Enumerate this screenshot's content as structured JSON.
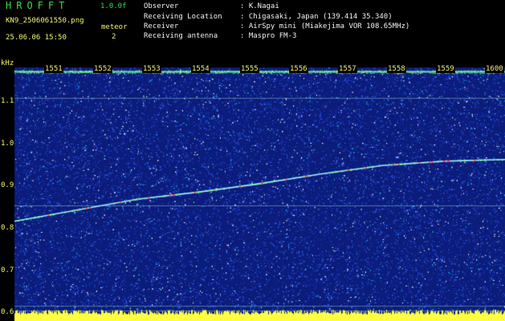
{
  "header": {
    "app_title": "HROFFT",
    "version": "1.0.0f",
    "filename": "KN9_2506061550.png",
    "meteor_label": "meteor",
    "meteor_count": "2",
    "datetime": "25.06.06 15:50"
  },
  "info": [
    {
      "key": "Observer",
      "value": ": K.Nagai"
    },
    {
      "key": "Receiving Location",
      "value": ": Chigasaki, Japan (139.414 35.340)"
    },
    {
      "key": "Receiver",
      "value": ": AirSpy mini (Miakejima VOR 108.65MHz)"
    },
    {
      "key": "Receiving antenna",
      "value": ": Maspro FM-3"
    }
  ],
  "chart_data": {
    "type": "heatmap",
    "ylabel": "kHz",
    "y_ticks": [
      "1.1",
      "1.0",
      "0.9",
      "0.8",
      "0.7",
      "0.6"
    ],
    "x_ticks": [
      "1551",
      "1552",
      "1553",
      "1554",
      "1555",
      "1556",
      "1557",
      "1558",
      "1559",
      "1600"
    ],
    "ylim": [
      0.58,
      1.18
    ],
    "trace": [
      {
        "t": "15:50",
        "khz": 0.816
      },
      {
        "t": "15:52",
        "khz": 0.842
      },
      {
        "t": "15:54",
        "khz": 0.868
      },
      {
        "t": "15:55",
        "khz": 0.885
      },
      {
        "t": "15:56",
        "khz": 0.905
      },
      {
        "t": "15:57",
        "khz": 0.928
      },
      {
        "t": "15:58",
        "khz": 0.948
      },
      {
        "t": "15:59",
        "khz": 0.958
      },
      {
        "t": "16:00",
        "khz": 0.962
      }
    ],
    "horizontal_lines_khz": [
      1.17,
      1.107,
      0.853,
      0.617,
      0.604
    ],
    "colors": {
      "background": "#0b1c7a",
      "noise": [
        "#1e3fd0",
        "#3b6cf0",
        "#ffffff",
        "#00e0ff"
      ],
      "trace": "#9ff0ff",
      "trace_hot": "#ff3b3b",
      "labels": "#f4f46e",
      "baseline": "#ffff40"
    }
  }
}
